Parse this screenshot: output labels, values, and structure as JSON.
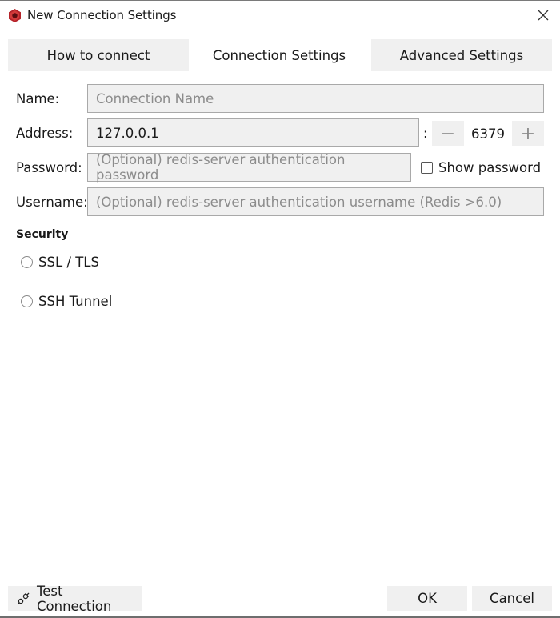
{
  "window": {
    "title": "New Connection Settings",
    "app_icon": "redis-app-icon",
    "close_icon": "close-icon",
    "accent_color": "#c0272d"
  },
  "tabs": [
    {
      "label": "How to connect",
      "active": false
    },
    {
      "label": "Connection Settings",
      "active": true
    },
    {
      "label": "Advanced Settings",
      "active": false
    }
  ],
  "form": {
    "name": {
      "label": "Name:",
      "value": "",
      "placeholder": "Connection Name"
    },
    "address": {
      "label": "Address:",
      "value": "127.0.0.1",
      "placeholder": ""
    },
    "port": {
      "separator": ":",
      "value": "6379",
      "decrement_label": "−",
      "increment_label": "+"
    },
    "password": {
      "label": "Password:",
      "value": "",
      "placeholder": "(Optional) redis-server authentication password"
    },
    "show_password": {
      "label": "Show password",
      "checked": false
    },
    "username": {
      "label": "Username:",
      "value": "",
      "placeholder": "(Optional) redis-server authentication username (Redis >6.0)"
    }
  },
  "security": {
    "title": "Security",
    "options": [
      {
        "label": "SSL / TLS",
        "selected": false
      },
      {
        "label": "SSH Tunnel",
        "selected": false
      }
    ]
  },
  "footer": {
    "test_connection_label": "Test Connection",
    "test_connection_icon": "plug-icon",
    "ok_label": "OK",
    "cancel_label": "Cancel"
  }
}
